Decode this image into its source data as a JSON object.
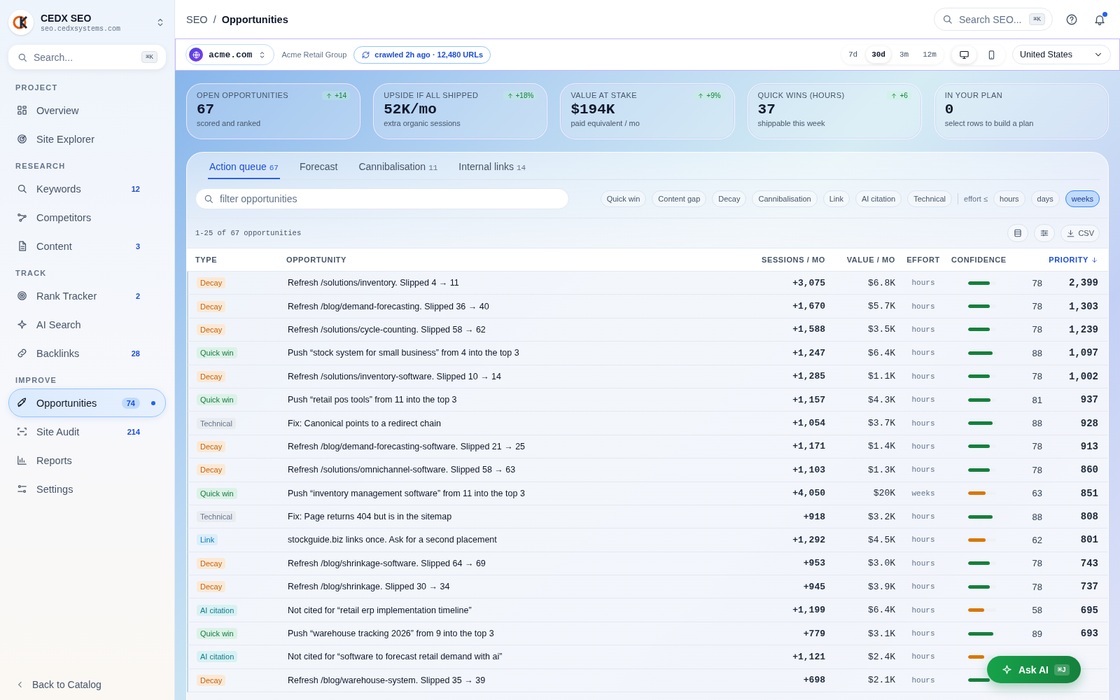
{
  "brand": {
    "name": "CEDX SEO",
    "domain": "seo.cedxsystems.com"
  },
  "sidebar": {
    "search": {
      "placeholder": "Search...",
      "shortcut": "⌘K"
    },
    "sections": [
      {
        "heading": "PROJECT",
        "items": [
          {
            "label": "Overview",
            "selected": false,
            "dot": false
          },
          {
            "label": "Site Explorer",
            "selected": false,
            "dot": false
          }
        ]
      },
      {
        "heading": "RESEARCH",
        "items": [
          {
            "label": "Keywords",
            "count": "12",
            "selected": false,
            "dot": false
          },
          {
            "label": "Competitors",
            "selected": false,
            "dot": false
          },
          {
            "label": "Content",
            "count": "3",
            "selected": false,
            "dot": false
          }
        ]
      },
      {
        "heading": "TRACK",
        "items": [
          {
            "label": "Rank Tracker",
            "count": "2",
            "selected": false,
            "dot": false
          },
          {
            "label": "AI Search",
            "selected": false,
            "dot": false
          },
          {
            "label": "Backlinks",
            "count": "28",
            "selected": false,
            "dot": false
          }
        ]
      },
      {
        "heading": "IMPROVE",
        "items": [
          {
            "label": "Opportunities",
            "count": "74",
            "selected": true,
            "dot": true
          },
          {
            "label": "Site Audit",
            "count": "214",
            "selected": false,
            "dot": false
          },
          {
            "label": "Reports",
            "selected": false,
            "dot": false
          },
          {
            "label": "Settings",
            "selected": false,
            "dot": false
          }
        ]
      }
    ],
    "back": "Back to Catalog"
  },
  "header": {
    "breadcrumb": [
      "SEO",
      "/",
      "Opportunities"
    ],
    "search": {
      "placeholder": "Search SEO...",
      "shortcut": "⌘K"
    },
    "notifications_unread": true
  },
  "context": {
    "site": "acme.com",
    "org": "Acme Retail Group",
    "crawl": "crawled 2h ago · 12,480 URLs",
    "periods": [
      {
        "label": "7d",
        "selected": false
      },
      {
        "label": "30d",
        "selected": true
      },
      {
        "label": "3m",
        "selected": false
      },
      {
        "label": "12m",
        "selected": false
      }
    ],
    "devices": [
      {
        "kind": "desktop",
        "selected": true
      },
      {
        "kind": "mobile",
        "selected": false
      }
    ],
    "country": "United States"
  },
  "kpis": [
    {
      "label": "OPEN OPPORTUNITIES",
      "value": "67",
      "note": "scored and ranked",
      "delta": "+14"
    },
    {
      "label": "UPSIDE IF ALL SHIPPED",
      "value": "52K/mo",
      "note": "extra organic sessions",
      "delta": "+18%"
    },
    {
      "label": "VALUE AT STAKE",
      "value": "$194K",
      "note": "paid equivalent / mo",
      "delta": "+9%"
    },
    {
      "label": "QUICK WINS (HOURS)",
      "value": "37",
      "note": "shippable this week",
      "delta": "+6"
    },
    {
      "label": "IN YOUR PLAN",
      "value": "0",
      "note": "select rows to build a plan"
    }
  ],
  "tabs": [
    {
      "label": "Action queue",
      "count": "67",
      "selected": true
    },
    {
      "label": "Forecast",
      "selected": false
    },
    {
      "label": "Cannibalisation",
      "count": "11",
      "selected": false
    },
    {
      "label": "Internal links",
      "count": "14",
      "selected": false
    }
  ],
  "filter": {
    "placeholder": "filter opportunities",
    "types": [
      {
        "label": "Quick win",
        "selected": false
      },
      {
        "label": "Content gap",
        "selected": false
      },
      {
        "label": "Decay",
        "selected": false
      },
      {
        "label": "Cannibalisation",
        "selected": false
      },
      {
        "label": "Link",
        "selected": false
      },
      {
        "label": "AI citation",
        "selected": false
      },
      {
        "label": "Technical",
        "selected": false
      }
    ],
    "effort_label": "effort ≤",
    "efforts": [
      {
        "label": "hours",
        "selected": false
      },
      {
        "label": "days",
        "selected": false
      },
      {
        "label": "weeks",
        "selected": true
      }
    ]
  },
  "count_text": "1-25 of 67 opportunities",
  "export_label": "CSV",
  "table": {
    "columns": [
      {
        "label": "TYPE",
        "sorted": false
      },
      {
        "label": "OPPORTUNITY",
        "sorted": false
      },
      {
        "label": "SESSIONS / MO",
        "sorted": false
      },
      {
        "label": "VALUE / MO",
        "sorted": false
      },
      {
        "label": "EFFORT",
        "sorted": false
      },
      {
        "label": "CONFIDENCE",
        "sorted": false
      },
      {
        "label": "PRIORITY",
        "sorted": true
      }
    ],
    "rows": [
      {
        "kind": "decay",
        "type": "Decay",
        "opportunity": "Refresh /solutions/inventory. Slipped 4 → 11",
        "sessions": "+3,075",
        "value": "$6.8K",
        "effort": "hours",
        "level": 0.78,
        "confidence": "78",
        "priority": "2,399"
      },
      {
        "kind": "decay",
        "type": "Decay",
        "opportunity": "Refresh /blog/demand-forecasting. Slipped 36 → 40",
        "sessions": "+1,670",
        "value": "$5.7K",
        "effort": "hours",
        "level": 0.78,
        "confidence": "78",
        "priority": "1,303"
      },
      {
        "kind": "decay",
        "type": "Decay",
        "opportunity": "Refresh /solutions/cycle-counting. Slipped 58 → 62",
        "sessions": "+1,588",
        "value": "$3.5K",
        "effort": "hours",
        "level": 0.78,
        "confidence": "78",
        "priority": "1,239"
      },
      {
        "kind": "quickwin",
        "type": "Quick win",
        "opportunity": "Push “stock system for small business” from 4 into the top 3",
        "sessions": "+1,247",
        "value": "$6.4K",
        "effort": "hours",
        "level": 0.88,
        "confidence": "88",
        "priority": "1,097"
      },
      {
        "kind": "decay",
        "type": "Decay",
        "opportunity": "Refresh /solutions/inventory-software. Slipped 10 → 14",
        "sessions": "+1,285",
        "value": "$1.1K",
        "effort": "hours",
        "level": 0.78,
        "confidence": "78",
        "priority": "1,002"
      },
      {
        "kind": "quickwin",
        "type": "Quick win",
        "opportunity": "Push “retail pos tools” from 11 into the top 3",
        "sessions": "+1,157",
        "value": "$4.3K",
        "effort": "hours",
        "level": 0.81,
        "confidence": "81",
        "priority": "937"
      },
      {
        "kind": "technical",
        "type": "Technical",
        "opportunity": "Fix: Canonical points to a redirect chain",
        "sessions": "+1,054",
        "value": "$3.7K",
        "effort": "hours",
        "level": 0.88,
        "confidence": "88",
        "priority": "928"
      },
      {
        "kind": "decay",
        "type": "Decay",
        "opportunity": "Refresh /blog/demand-forecasting-software. Slipped 21 → 25",
        "sessions": "+1,171",
        "value": "$1.4K",
        "effort": "hours",
        "level": 0.78,
        "confidence": "78",
        "priority": "913"
      },
      {
        "kind": "decay",
        "type": "Decay",
        "opportunity": "Refresh /solutions/omnichannel-software. Slipped 58 → 63",
        "sessions": "+1,103",
        "value": "$1.3K",
        "effort": "hours",
        "level": 0.78,
        "confidence": "78",
        "priority": "860"
      },
      {
        "kind": "quickwin",
        "type": "Quick win",
        "opportunity": "Push “inventory management software” from 11 into the top 3",
        "sessions": "+4,050",
        "value": "$20K",
        "effort": "weeks",
        "level": 0.63,
        "confidence": "63",
        "priority": "851"
      },
      {
        "kind": "technical",
        "type": "Technical",
        "opportunity": "Fix: Page returns 404 but is in the sitemap",
        "sessions": "+918",
        "value": "$3.2K",
        "effort": "hours",
        "level": 0.88,
        "confidence": "88",
        "priority": "808"
      },
      {
        "kind": "link",
        "type": "Link",
        "opportunity": "stockguide.biz links once. Ask for a second placement",
        "sessions": "+1,292",
        "value": "$4.5K",
        "effort": "hours",
        "level": 0.62,
        "confidence": "62",
        "priority": "801"
      },
      {
        "kind": "decay",
        "type": "Decay",
        "opportunity": "Refresh /blog/shrinkage-software. Slipped 64 → 69",
        "sessions": "+953",
        "value": "$3.0K",
        "effort": "hours",
        "level": 0.78,
        "confidence": "78",
        "priority": "743"
      },
      {
        "kind": "decay",
        "type": "Decay",
        "opportunity": "Refresh /blog/shrinkage. Slipped 30 → 34",
        "sessions": "+945",
        "value": "$3.9K",
        "effort": "hours",
        "level": 0.78,
        "confidence": "78",
        "priority": "737"
      },
      {
        "kind": "aicitation",
        "type": "AI citation",
        "opportunity": "Not cited for “retail erp implementation timeline”",
        "sessions": "+1,199",
        "value": "$6.4K",
        "effort": "hours",
        "level": 0.58,
        "confidence": "58",
        "priority": "695"
      },
      {
        "kind": "quickwin",
        "type": "Quick win",
        "opportunity": "Push “warehouse tracking 2026” from 9 into the top 3",
        "sessions": "+779",
        "value": "$3.1K",
        "effort": "hours",
        "level": 0.89,
        "confidence": "89",
        "priority": "693"
      },
      {
        "kind": "aicitation",
        "type": "AI citation",
        "opportunity": "Not cited for “software to forecast retail demand with ai”",
        "sessions": "+1,121",
        "value": "$2.4K",
        "effort": "hours",
        "level": 0.58
      },
      {
        "kind": "decay",
        "type": "Decay",
        "opportunity": "Refresh /blog/warehouse-system. Slipped 35 → 39",
        "sessions": "+698",
        "value": "$2.1K",
        "effort": "hours",
        "level": 0.78
      }
    ]
  },
  "assistant": {
    "label": "Ask AI",
    "shortcut": "⌘J"
  }
}
